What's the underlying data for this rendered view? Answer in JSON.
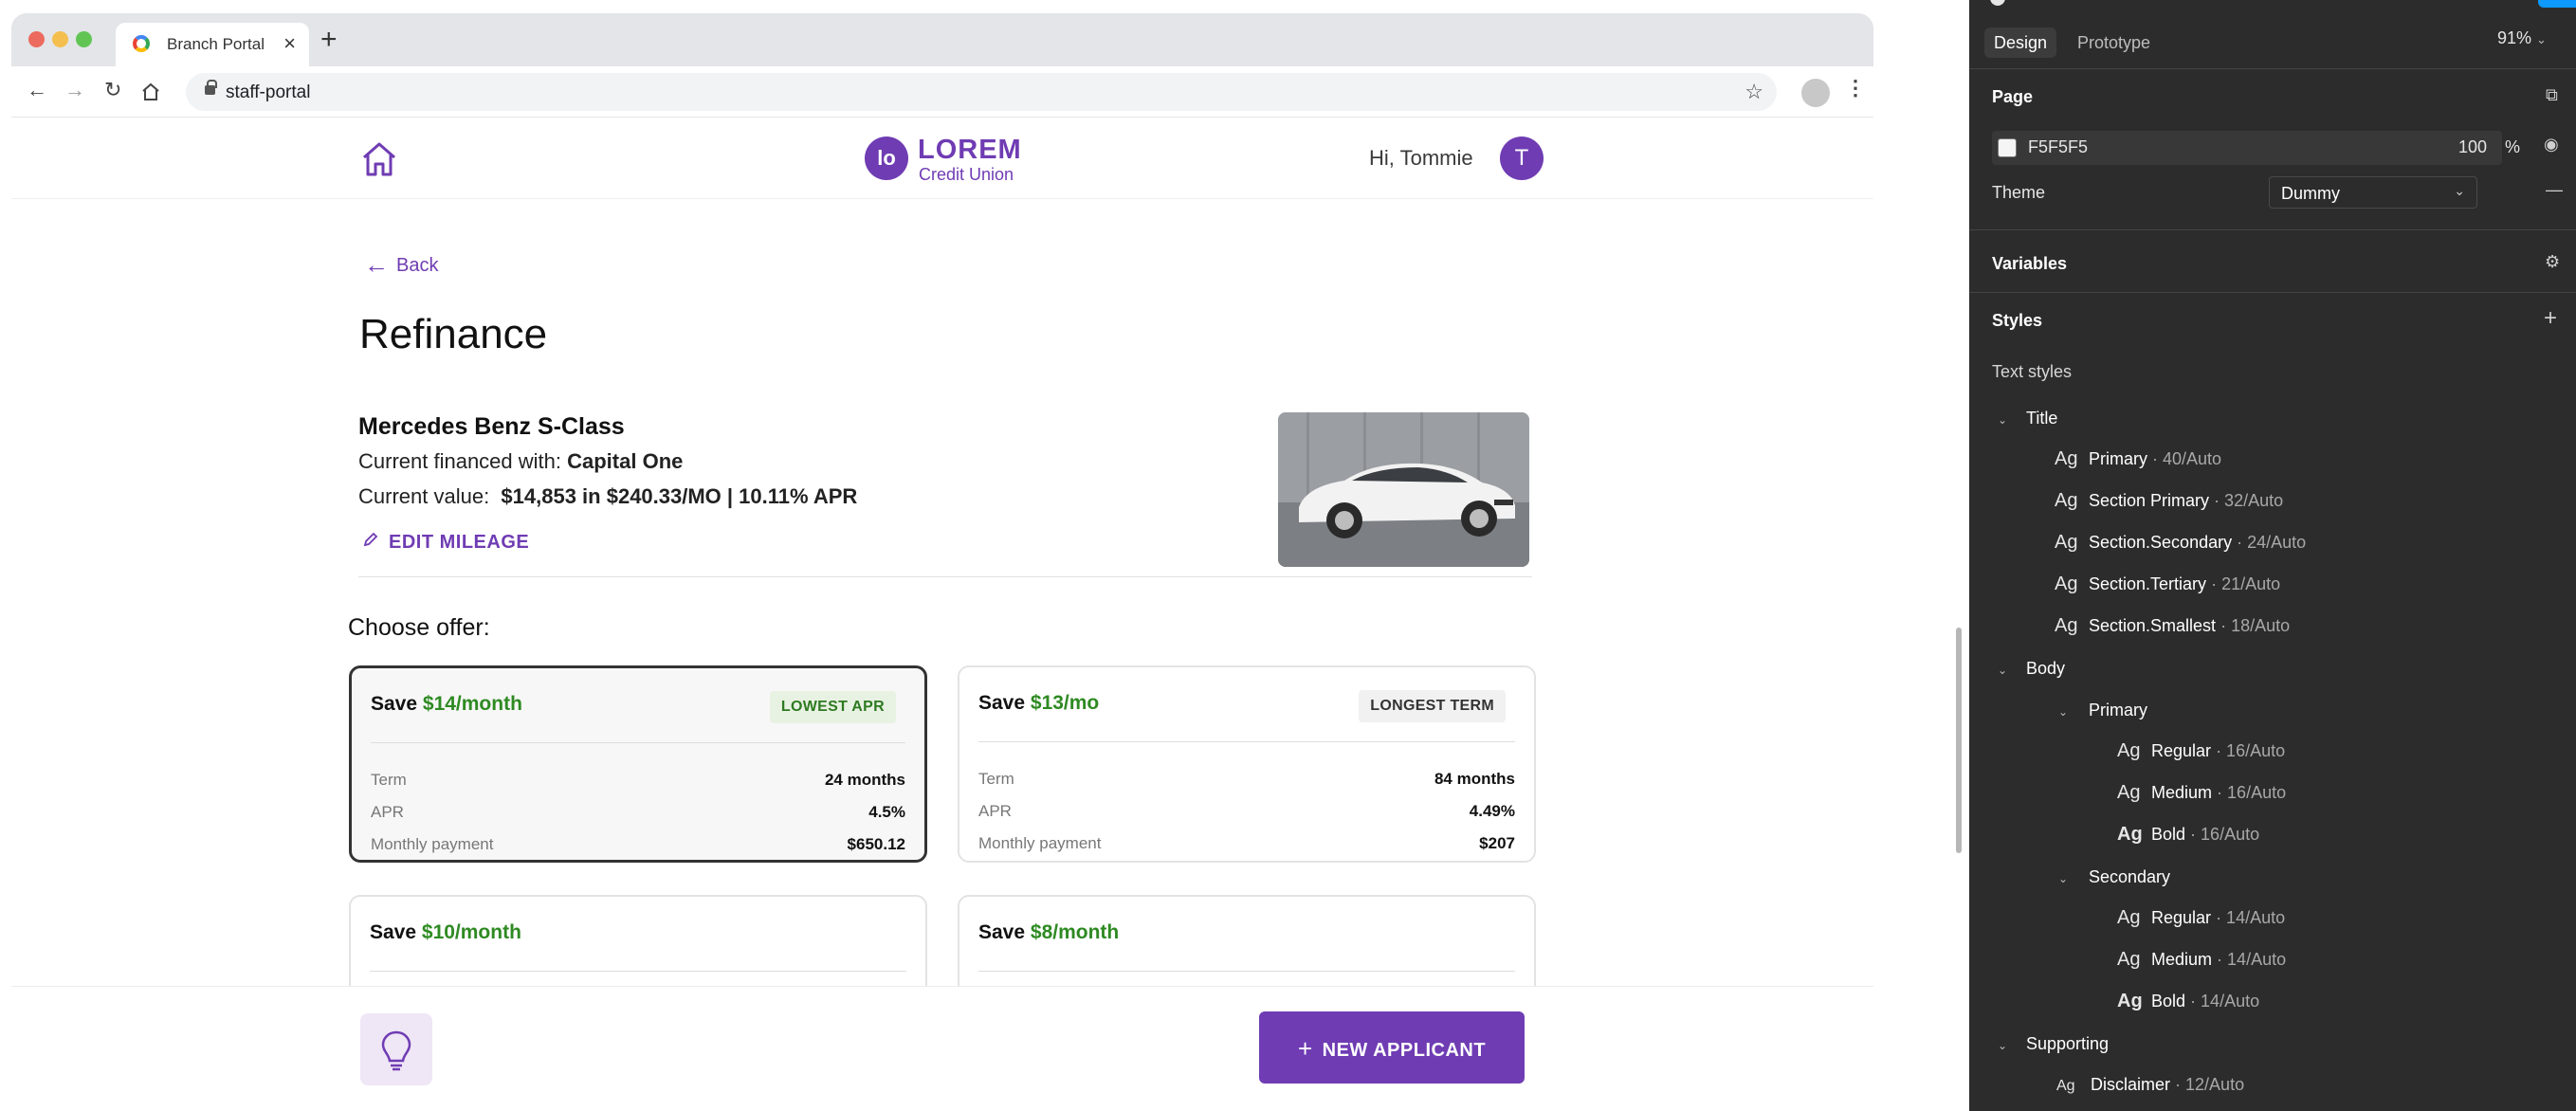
{
  "browser": {
    "tab_title": "Branch Portal",
    "url": "staff-portal"
  },
  "app": {
    "logo_mark": "lo",
    "logo_name": "LOREM",
    "logo_sub": "Credit Union",
    "greeting": "Hi, Tommie",
    "avatar_initial": "T",
    "back_label": "Back",
    "page_title": "Refinance",
    "vehicle": {
      "name": "Mercedes Benz S-Class",
      "financed_label": "Current financed with:",
      "financed_with": "Capital One",
      "value_label": "Current value:",
      "value": "$14,853 in $240.33/MO | 10.11% APR",
      "edit_label": "EDIT MILEAGE"
    },
    "choose_label": "Choose offer:",
    "offers": [
      {
        "save_prefix": "Save",
        "save_amount": "$14/month",
        "tag": "LOWEST APR",
        "rows": [
          {
            "k": "Term",
            "v": "24 months"
          },
          {
            "k": "APR",
            "v": "4.5%"
          },
          {
            "k": "Monthly payment",
            "v": "$650.12"
          }
        ]
      },
      {
        "save_prefix": "Save",
        "save_amount": "$13/mo",
        "tag": "LONGEST TERM",
        "rows": [
          {
            "k": "Term",
            "v": "84 months"
          },
          {
            "k": "APR",
            "v": "4.49%"
          },
          {
            "k": "Monthly payment",
            "v": "$207"
          }
        ]
      },
      {
        "save_prefix": "Save",
        "save_amount": "$10/month"
      },
      {
        "save_prefix": "Save",
        "save_amount": "$8/month"
      }
    ],
    "new_applicant_label": "NEW APPLICANT"
  },
  "panel": {
    "tabs": [
      "Design",
      "Prototype"
    ],
    "zoom": "91%",
    "page_heading": "Page",
    "page_color": "F5F5F5",
    "page_opacity": "100",
    "page_opacity_unit": "%",
    "theme_label": "Theme",
    "theme_value": "Dummy",
    "variables_heading": "Variables",
    "styles_heading": "Styles",
    "text_styles_label": "Text styles",
    "groups": {
      "title": "Title",
      "body": "Body",
      "primary": "Primary",
      "secondary": "Secondary",
      "supporting": "Supporting"
    },
    "title_styles": [
      {
        "name": "Primary",
        "size": "· 40/Auto"
      },
      {
        "name": "Section Primary",
        "size": "· 32/Auto"
      },
      {
        "name": "Section.Secondary",
        "size": "· 24/Auto"
      },
      {
        "name": "Section.Tertiary",
        "size": "· 21/Auto"
      },
      {
        "name": "Section.Smallest",
        "size": "· 18/Auto"
      }
    ],
    "body_primary_styles": [
      {
        "name": "Regular",
        "size": "· 16/Auto"
      },
      {
        "name": "Medium",
        "size": "· 16/Auto"
      },
      {
        "name": "Bold",
        "size": "· 16/Auto"
      }
    ],
    "body_secondary_styles": [
      {
        "name": "Regular",
        "size": "· 14/Auto"
      },
      {
        "name": "Medium",
        "size": "· 14/Auto"
      },
      {
        "name": "Bold",
        "size": "· 14/Auto"
      }
    ],
    "supporting_styles": [
      {
        "name": "Disclaimer",
        "size": "· 12/Auto"
      }
    ],
    "ag_glyph": "Ag"
  }
}
